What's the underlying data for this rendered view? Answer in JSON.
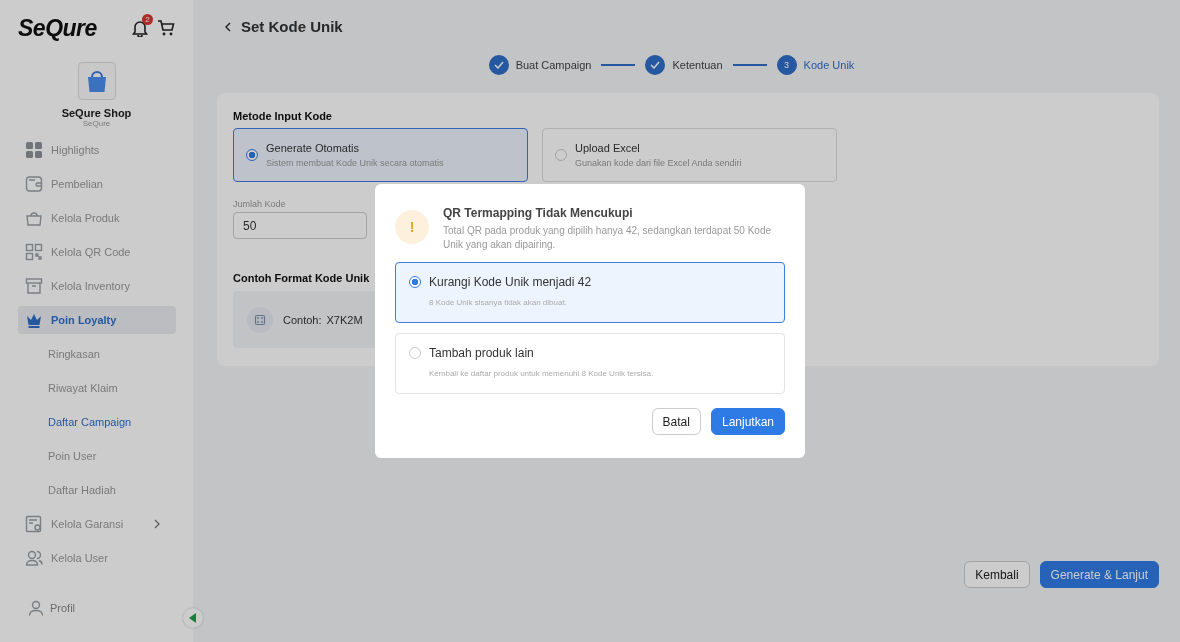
{
  "sidebar": {
    "logo": "SeQure",
    "notification_count": "2",
    "shop": {
      "name": "SeQure Shop",
      "subtitle": "SeQure"
    },
    "items": [
      {
        "label": "Highlights",
        "selected": false
      },
      {
        "label": "Pembelian",
        "selected": false
      },
      {
        "label": "Kelola Produk",
        "selected": false
      },
      {
        "label": "Kelola QR Code",
        "selected": false
      },
      {
        "label": "Kelola Inventory",
        "selected": false
      },
      {
        "label": "Poin Loyalty",
        "selected": true,
        "children": [
          {
            "label": "Ringkasan",
            "selected": false
          },
          {
            "label": "Riwayat Klaim",
            "selected": false
          },
          {
            "label": "Daftar Campaign",
            "selected": true
          },
          {
            "label": "Poin User",
            "selected": false
          },
          {
            "label": "Daftar Hadiah",
            "selected": false
          }
        ]
      },
      {
        "label": "Kelola Garansi",
        "selected": false,
        "has_submenu": true
      },
      {
        "label": "Kelola User",
        "selected": false
      }
    ],
    "footer_items": [
      {
        "label": "Profil"
      }
    ]
  },
  "page": {
    "title": "Set Kode Unik",
    "steps": [
      {
        "label": "Buat Campaign",
        "completed": true,
        "selected": false
      },
      {
        "label": "Ketentuan",
        "completed": true,
        "selected": false
      },
      {
        "label": "Kode Unik",
        "completed": false,
        "selected": true,
        "number": "3"
      }
    ],
    "method_label": "Metode Input Kode",
    "methods": [
      {
        "title": "Generate Otomatis",
        "description": "Sistem membuat Kode Unik secara otomatis",
        "selected": true
      },
      {
        "title": "Upload Excel",
        "description": "Gunakan kode dari file Excel Anda sendiri",
        "selected": false
      }
    ],
    "quantity": {
      "label": "Jumlah Kode",
      "value": "50"
    },
    "example": {
      "label": "Contoh Format Kode Unik",
      "prefix": "Contoh:",
      "code": "X7K2M"
    },
    "buttons": [
      {
        "label": "Kembali",
        "kind": "secondary"
      },
      {
        "label": "Generate & Lanjut",
        "kind": "primary"
      }
    ]
  },
  "dialog": {
    "icon_glyph": "!",
    "title": "QR Termapping Tidak Mencukupi",
    "message": "Total QR pada produk yang dipilih hanya 42, sedangkan terdapat 50 Kode Unik yang akan dipairing.",
    "options": [
      {
        "title": "Kurangi Kode Unik menjadi 42",
        "description": "8 Kode Unik sisanya tidak akan dibuat.",
        "selected": true
      },
      {
        "title": "Tambah produk lain",
        "description": "Kembali ke daftar produk untuk memenuhi 8 Kode Unik tersisa.",
        "selected": false
      }
    ],
    "buttons": [
      {
        "label": "Batal",
        "kind": "secondary"
      },
      {
        "label": "Lanjutkan",
        "kind": "primary"
      }
    ]
  }
}
